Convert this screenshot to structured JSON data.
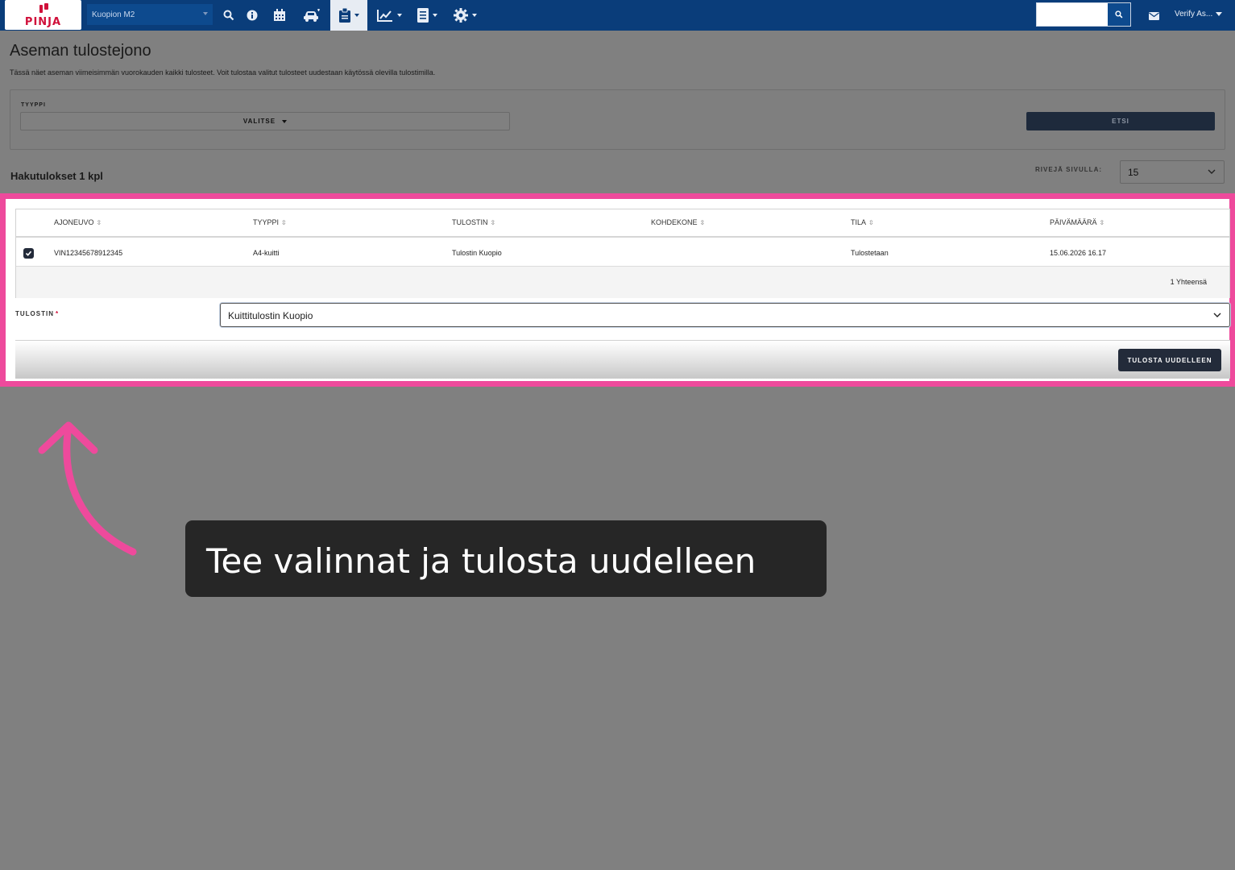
{
  "nav": {
    "logo_text": "PINJA",
    "station": "Kuopion M2",
    "user": "Verify As...",
    "search_placeholder": ""
  },
  "page": {
    "title": "Aseman tulostejono",
    "description": "Tässä näet aseman viimeisimmän vuorokauden kaikki tulosteet. Voit tulostaa valitut tulosteet uudestaan käytössä olevilla tulostimilla."
  },
  "filter": {
    "type_label": "TYYPPI",
    "type_value": "VALITSE",
    "search_button": "ETSI"
  },
  "results": {
    "count_label": "Hakutulokset 1 kpl",
    "rows_per_page_label": "RIVEJÄ SIVULLA:",
    "rows_per_page_value": "15"
  },
  "table": {
    "columns": [
      "AJONEUVO",
      "TYYPPI",
      "TULOSTIN",
      "KOHDEKONE",
      "TILA",
      "PÄIVÄMÄÄRÄ"
    ],
    "rows": [
      {
        "checked": true,
        "cells": [
          "VIN12345678912345",
          "A4-kuitti",
          "Tulostin Kuopio",
          "",
          "Tulostetaan",
          "15.06.2026 16.17"
        ]
      }
    ],
    "total": "1 Yhteensä"
  },
  "printer": {
    "label": "TULOSTIN",
    "required_mark": "*",
    "value": "Kuittitulostin Kuopio"
  },
  "actions": {
    "reprint_button": "TULOSTA UUDELLEEN"
  },
  "annotation": {
    "text": "Tee valinnat ja tulosta uudelleen"
  },
  "colors": {
    "nav_background": "#0a3d7a",
    "highlight": "#ee4a9c",
    "primary_button": "#232b3a",
    "overlay": "#808080"
  },
  "icons": [
    "search-icon",
    "info-icon",
    "calendar-icon",
    "car-icon",
    "clipboard-icon",
    "chart-icon",
    "document-icon",
    "gear-icon",
    "mail-icon",
    "chevron-down-icon",
    "checkmark-icon",
    "arrow-icon"
  ]
}
